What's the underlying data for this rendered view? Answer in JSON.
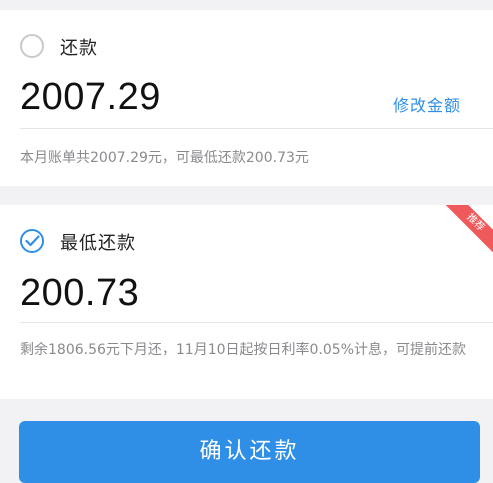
{
  "options": [
    {
      "title": "还款",
      "amount": "2007.29",
      "selected": false,
      "edit_label": "修改金额",
      "note": "本月账单共2007.29元，可最低还款200.73元"
    },
    {
      "title": "最低还款",
      "amount": "200.73",
      "selected": true,
      "badge": "推荐",
      "note": "剩余1806.56元下月还，11月10日起按日利率0.05%计息，可提前还款"
    }
  ],
  "confirm_label": "确认还款",
  "colors": {
    "accent": "#2f8fe6",
    "badge": "#f0595b",
    "muted_text": "#8a8a8e"
  }
}
